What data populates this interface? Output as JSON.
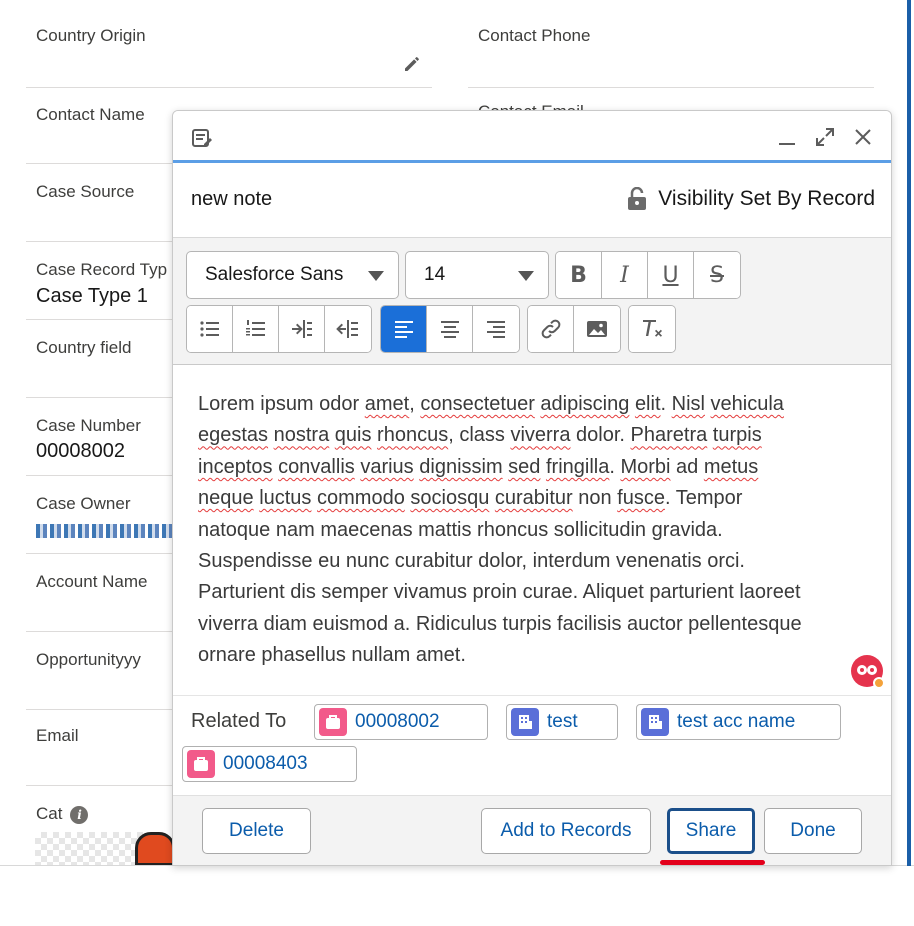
{
  "record_fields": {
    "country_origin": {
      "label": "Country Origin"
    },
    "contact_phone": {
      "label": "Contact Phone"
    },
    "contact_name": {
      "label": "Contact Name"
    },
    "contact_email_partial": {
      "label": "Contact Email"
    },
    "case_source": {
      "label": "Case Source"
    },
    "case_record_type": {
      "label": "Case Record Typ",
      "value": "Case Type 1"
    },
    "country_field": {
      "label": "Country field"
    },
    "case_number": {
      "label": "Case Number",
      "value": "00008002"
    },
    "case_owner": {
      "label": "Case Owner"
    },
    "account_name": {
      "label": "Account Name"
    },
    "opportunity": {
      "label": "Opportunityyy"
    },
    "email": {
      "label": "Email"
    },
    "cat": {
      "label": "Cat"
    }
  },
  "note": {
    "title": "new note",
    "visibility": "Visibility Set By Record",
    "font_family": "Salesforce Sans",
    "font_size": "14",
    "body": {
      "l1a": "Lorem ipsum odor ",
      "l1b": "amet",
      "l1c": ", ",
      "l1d": "consectetuer",
      "l1e": " ",
      "l1f": "adipiscing",
      "l1g": " ",
      "l1h": "elit",
      "l1i": ". ",
      "l1j": "Nisl",
      "l1k": " ",
      "l1l": "vehicula",
      "l2a": "egestas",
      "l2b": " ",
      "l2c": "nostra",
      "l2d": " ",
      "l2e": "quis",
      "l2f": " ",
      "l2g": "rhoncus",
      "l2h": ", class ",
      "l2i": "viverra",
      "l2j": " dolor. ",
      "l2k": "Pharetra",
      "l2l": " ",
      "l2m": "turpis",
      "l3a": "inceptos",
      "l3b": " ",
      "l3c": "convallis",
      "l3d": " ",
      "l3e": "varius",
      "l3f": " ",
      "l3g": "dignissim",
      "l3h": " ",
      "l3i": "sed",
      "l3j": " ",
      "l3k": "fringilla",
      "l3l": ". ",
      "l3m": "Morbi",
      "l3n": " ad ",
      "l3o": "metus",
      "l4a": "neque",
      "l4b": " ",
      "l4c": "luctus",
      "l4d": " ",
      "l4e": "commodo",
      "l4f": " ",
      "l4g": "sociosqu",
      "l4h": " ",
      "l4i": "curabitur",
      "l4j": " non ",
      "l4k": "fusce",
      "l4l": ". Tempor",
      "l5": "natoque nam maecenas mattis rhoncus sollicitudin gravida.",
      "l6": "Suspendisse eu nunc curabitur dolor, interdum venenatis orci.",
      "l7": "Parturient dis semper vivamus proin curae. Aliquet parturient laoreet",
      "l8": "viverra diam euismod a. Ridiculus turpis facilisis auctor pellentesque",
      "l9": "ornare phasellus nullam amet."
    },
    "related_label": "Related To",
    "related": [
      "00008002",
      "test",
      "test acc name",
      "00008403"
    ]
  },
  "footer": {
    "delete": "Delete",
    "add_to_records": "Add to Records",
    "share": "Share",
    "done": "Done"
  },
  "colors": {
    "accent": "#1b6fd8",
    "brand_link": "#0b5cab",
    "case_icon": "#f25a8a",
    "account_icon": "#5a6fd8",
    "highlight": "#e3001b"
  }
}
